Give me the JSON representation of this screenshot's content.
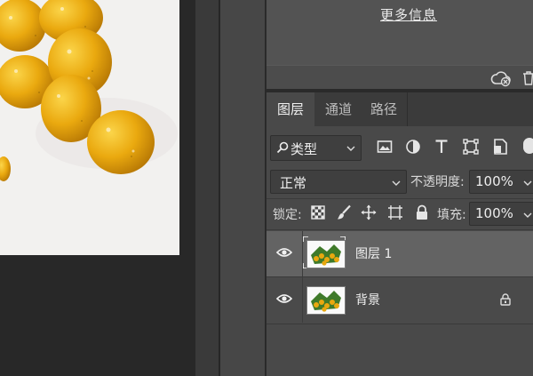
{
  "info_panel": {
    "more_info_link": "更多信息"
  },
  "layers_panel": {
    "tabs": [
      {
        "label": "图层",
        "active": true
      },
      {
        "label": "通道",
        "active": false
      },
      {
        "label": "路径",
        "active": false
      }
    ],
    "filter": {
      "selected": "类型",
      "icons": [
        "pixel-layer-filter-icon",
        "adjustment-layer-filter-icon",
        "type-layer-filter-icon",
        "shape-layer-filter-icon",
        "smart-object-filter-icon"
      ]
    },
    "blend_mode": "正常",
    "opacity_label": "不透明度:",
    "opacity_value": "100%",
    "lock_label": "锁定:",
    "lock_icons": [
      "lock-transparent-pixels-icon",
      "lock-image-pixels-icon",
      "lock-position-icon",
      "lock-artboard-icon",
      "lock-all-icon"
    ],
    "fill_label": "填充:",
    "fill_value": "100%",
    "layers": [
      {
        "name": "图层 1",
        "visible": true,
        "selected": true,
        "locked": false
      },
      {
        "name": "背景",
        "visible": true,
        "selected": false,
        "locked": true
      }
    ]
  },
  "colors": {
    "panel_bg": "#494949",
    "selected_row": "#636363",
    "canvas_bg": "#282828",
    "fruit": "#e9a80f"
  }
}
